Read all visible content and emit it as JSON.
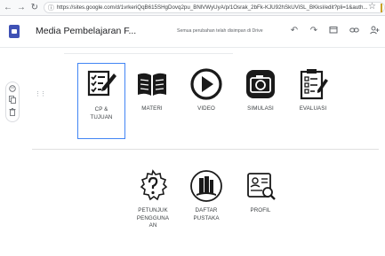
{
  "browser": {
    "back_icon": "arrow-left",
    "forward_icon": "arrow-right",
    "reload_icon": "reload",
    "url": "https://sites.google.com/d/1vrkeriQqB615SHgDovq2pu_BNlVWyUyA/p/1Osrak_2bFk-KJU92hSkUViSL_BKksl/edit?pli=1&auth...",
    "star_icon": "star"
  },
  "header": {
    "title": "Media Pembelajaran F...",
    "save_status": "Semua perubahan telah disimpan di Drive",
    "icons": [
      "undo-icon",
      "redo-icon",
      "preview-icon",
      "link-icon",
      "share-icon"
    ]
  },
  "rail": {
    "icons": [
      "palette-icon",
      "duplicate-icon",
      "delete-icon"
    ]
  },
  "row1": [
    {
      "label_lines": [
        "CP &",
        "TUJUAN"
      ],
      "icon": "checklist-pen",
      "selected": true
    },
    {
      "label_lines": [
        "MATERI"
      ],
      "icon": "open-book"
    },
    {
      "label_lines": [
        "VIDEO"
      ],
      "icon": "play-circle"
    },
    {
      "label_lines": [
        "SIMULASI"
      ],
      "icon": "camera"
    },
    {
      "label_lines": [
        "EVALUASI"
      ],
      "icon": "clipboard-check"
    }
  ],
  "row2": [
    {
      "label_lines": [
        "PETUNJUK",
        "PENGGUNA",
        "AN"
      ],
      "icon": "gear-question"
    },
    {
      "label_lines": [
        "DAFTAR",
        "PUSTAKA"
      ],
      "icon": "book-stack"
    },
    {
      "label_lines": [
        "PROFIL"
      ],
      "icon": "profile-card"
    }
  ],
  "colors": {
    "accent": "#4285f4",
    "sites_brand": "#3f51b5",
    "icon_black": "#1a1a1a"
  }
}
